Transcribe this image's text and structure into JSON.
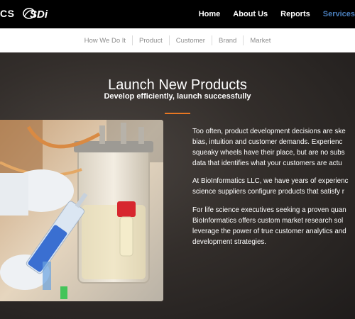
{
  "header": {
    "brand_partial": "CS",
    "logo_text": "SDi",
    "nav": [
      {
        "label": "Home"
      },
      {
        "label": "About Us"
      },
      {
        "label": "Reports"
      },
      {
        "label": "Services"
      }
    ],
    "active_index": 3,
    "accent_color": "#4a7fbd"
  },
  "subnav": {
    "items": [
      {
        "label": "How We Do It"
      },
      {
        "label": "Product"
      },
      {
        "label": "Customer"
      },
      {
        "label": "Brand"
      },
      {
        "label": "Market"
      }
    ]
  },
  "hero": {
    "title": "Launch New Products",
    "subtitle": "Develop efficiently, launch successfully",
    "divider_color": "#e87722",
    "image_subject": "Gloved hands holding a blue-liquid syringe beside a lab bioreactor vessel with a red-capped tube",
    "paragraphs": [
      {
        "lines": [
          "Too often, product development decisions are ske",
          "bias, intuition and customer demands. Experienc",
          "squeaky wheels have their place, but are no subs",
          "data that identifies what your customers are actu"
        ]
      },
      {
        "lines": [
          "At BioInformatics LLC, we have years of experienc",
          "science suppliers configure products that satisfy r"
        ]
      },
      {
        "lines": [
          "For life science executives seeking a proven quan",
          "BioInformatics offers custom market research sol",
          "leverage the power of true customer analytics and",
          "development strategies."
        ]
      }
    ]
  }
}
